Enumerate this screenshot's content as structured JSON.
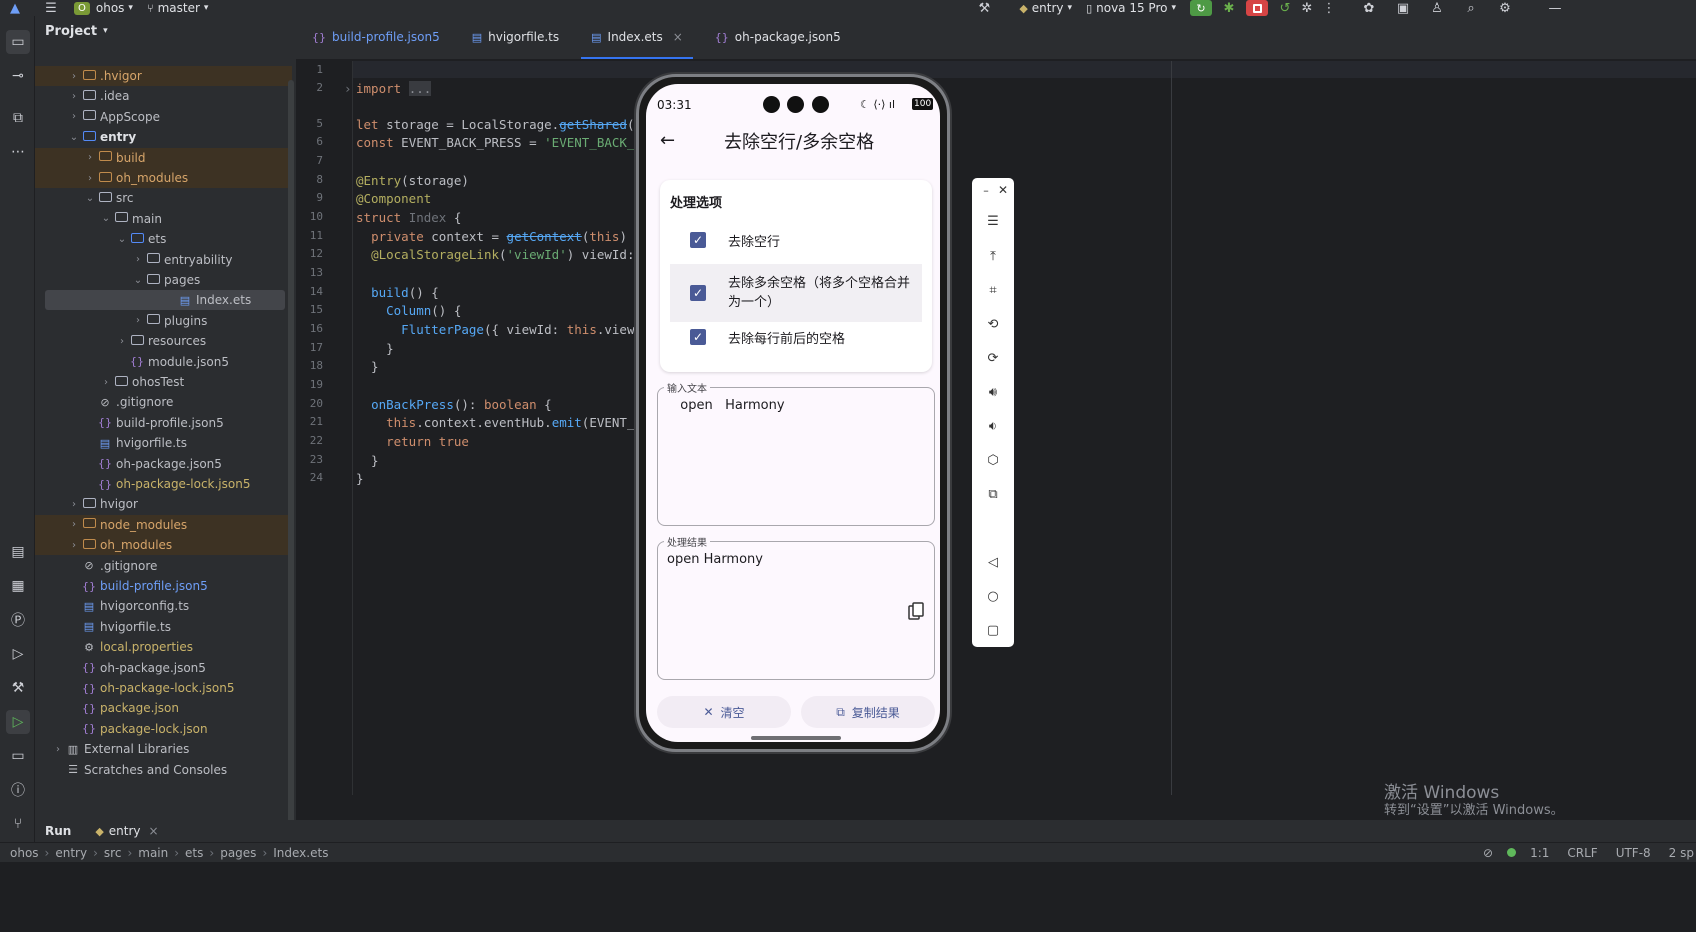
{
  "topbar": {
    "project_badge": "O",
    "project_name": "ohos",
    "branch": "master",
    "run_config": "entry",
    "device": "nova 15 Pro"
  },
  "project_panel": {
    "title": "Project",
    "items": [
      {
        "label": ".hvigor",
        "indent": 2,
        "arrow": ">",
        "kind": "folder-orange",
        "style": "orange",
        "excluded": true
      },
      {
        "label": ".idea",
        "indent": 2,
        "arrow": ">",
        "kind": "folder",
        "style": "normal"
      },
      {
        "label": "AppScope",
        "indent": 2,
        "arrow": ">",
        "kind": "folder",
        "style": "normal"
      },
      {
        "label": "entry",
        "indent": 2,
        "arrow": "v",
        "kind": "folder-blue",
        "style": "bold"
      },
      {
        "label": "build",
        "indent": 3,
        "arrow": ">",
        "kind": "folder-orange",
        "style": "orange",
        "excluded": true
      },
      {
        "label": "oh_modules",
        "indent": 3,
        "arrow": ">",
        "kind": "folder-orange",
        "style": "orange",
        "excluded": true
      },
      {
        "label": "src",
        "indent": 3,
        "arrow": "v",
        "kind": "folder",
        "style": "normal"
      },
      {
        "label": "main",
        "indent": 4,
        "arrow": "v",
        "kind": "folder",
        "style": "normal"
      },
      {
        "label": "ets",
        "indent": 5,
        "arrow": "v",
        "kind": "folder-blue",
        "style": "normal"
      },
      {
        "label": "entryability",
        "indent": 6,
        "arrow": ">",
        "kind": "folder",
        "style": "normal"
      },
      {
        "label": "pages",
        "indent": 6,
        "arrow": "v",
        "kind": "folder",
        "style": "normal"
      },
      {
        "label": "Index.ets",
        "indent": 8,
        "arrow": "",
        "kind": "ets-file",
        "style": "normal",
        "selected": true
      },
      {
        "label": "plugins",
        "indent": 6,
        "arrow": ">",
        "kind": "folder",
        "style": "normal"
      },
      {
        "label": "resources",
        "indent": 5,
        "arrow": ">",
        "kind": "folder",
        "style": "normal"
      },
      {
        "label": "module.json5",
        "indent": 5,
        "arrow": "",
        "kind": "json",
        "style": "normal"
      },
      {
        "label": "ohosTest",
        "indent": 4,
        "arrow": ">",
        "kind": "folder",
        "style": "normal"
      },
      {
        "label": ".gitignore",
        "indent": 3,
        "arrow": "",
        "kind": "ignore",
        "style": "normal"
      },
      {
        "label": "build-profile.json5",
        "indent": 3,
        "arrow": "",
        "kind": "json",
        "style": "normal"
      },
      {
        "label": "hvigorfile.ts",
        "indent": 3,
        "arrow": "",
        "kind": "ts-file",
        "style": "normal"
      },
      {
        "label": "oh-package.json5",
        "indent": 3,
        "arrow": "",
        "kind": "json",
        "style": "normal"
      },
      {
        "label": "oh-package-lock.json5",
        "indent": 3,
        "arrow": "",
        "kind": "json",
        "style": "yellow"
      },
      {
        "label": "hvigor",
        "indent": 2,
        "arrow": ">",
        "kind": "folder",
        "style": "normal"
      },
      {
        "label": "node_modules",
        "indent": 2,
        "arrow": ">",
        "kind": "folder-orange",
        "style": "orange",
        "excluded": true
      },
      {
        "label": "oh_modules",
        "indent": 2,
        "arrow": ">",
        "kind": "folder-orange",
        "style": "orange",
        "excluded": true
      },
      {
        "label": ".gitignore",
        "indent": 2,
        "arrow": "",
        "kind": "ignore",
        "style": "normal"
      },
      {
        "label": "build-profile.json5",
        "indent": 2,
        "arrow": "",
        "kind": "json",
        "style": "blue"
      },
      {
        "label": "hvigorconfig.ts",
        "indent": 2,
        "arrow": "",
        "kind": "ts-file",
        "style": "normal"
      },
      {
        "label": "hvigorfile.ts",
        "indent": 2,
        "arrow": "",
        "kind": "ts-file",
        "style": "normal"
      },
      {
        "label": "local.properties",
        "indent": 2,
        "arrow": "",
        "kind": "props",
        "style": "yellow"
      },
      {
        "label": "oh-package.json5",
        "indent": 2,
        "arrow": "",
        "kind": "json",
        "style": "normal"
      },
      {
        "label": "oh-package-lock.json5",
        "indent": 2,
        "arrow": "",
        "kind": "json",
        "style": "yellow"
      },
      {
        "label": "package.json",
        "indent": 2,
        "arrow": "",
        "kind": "json",
        "style": "yellow"
      },
      {
        "label": "package-lock.json",
        "indent": 2,
        "arrow": "",
        "kind": "json",
        "style": "yellow"
      },
      {
        "label": "External Libraries",
        "indent": 1,
        "arrow": ">",
        "kind": "lib",
        "style": "normal"
      },
      {
        "label": "Scratches and Consoles",
        "indent": 1,
        "arrow": "",
        "kind": "scratch",
        "style": "normal"
      }
    ]
  },
  "tabs": [
    {
      "label": "build-profile.json5",
      "icon": "{}",
      "active": false,
      "color": "#6e9ef7"
    },
    {
      "label": "hvigorfile.ts",
      "icon": "▤",
      "active": false,
      "color": "#dfe1e5"
    },
    {
      "label": "Index.ets",
      "icon": "▤",
      "active": true,
      "color": "#dfe1e5",
      "close": "×"
    },
    {
      "label": "oh-package.json5",
      "icon": "{}",
      "active": false,
      "color": "#dfe1e5"
    }
  ],
  "editor": {
    "line_numbers": [
      "1",
      "2",
      "5",
      "6",
      "7",
      "8",
      "9",
      "10",
      "11",
      "12",
      "13",
      "14",
      "15",
      "16",
      "17",
      "18",
      "19",
      "20",
      "21",
      "22",
      "23",
      "24"
    ]
  },
  "phone": {
    "time": "03:31",
    "battery": "100",
    "title": "去除空行/多余空格",
    "card_title": "处理选项",
    "options": [
      {
        "label": "去除空行",
        "checked": true
      },
      {
        "label": "去除多余空格（将多个空格合并为一个）",
        "checked": true
      },
      {
        "label": "去除每行前后的空格",
        "checked": true
      }
    ],
    "input_label": "输入文本",
    "input_value": "  open   Harmony",
    "result_label": "处理结果",
    "result_value": "open Harmony",
    "clear_button": "清空",
    "copy_button": "复制结果"
  },
  "runbar": {
    "tab": "Run",
    "config": "entry"
  },
  "statusbar": {
    "breadcrumb": [
      "ohos",
      "entry",
      "src",
      "main",
      "ets",
      "pages",
      "Index.ets"
    ],
    "position": "1:1",
    "line_sep": "CRLF",
    "encoding": "UTF-8",
    "indent": "2 sp"
  },
  "watermark": {
    "line1": "激活 Windows",
    "line2": "转到“设置”以激活 Windows。"
  }
}
